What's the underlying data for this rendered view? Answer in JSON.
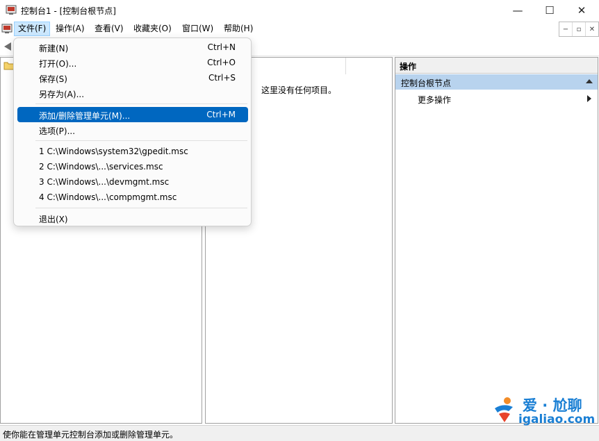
{
  "window": {
    "title": "控制台1 - [控制台根节点]",
    "minimize_glyph": "—",
    "maximize_glyph": "☐",
    "close_glyph": "✕"
  },
  "menubar": {
    "items": [
      "文件(F)",
      "操作(A)",
      "查看(V)",
      "收藏夹(O)",
      "窗口(W)",
      "帮助(H)"
    ],
    "active": "文件(F)"
  },
  "mdi_controls": [
    "−",
    "▫",
    "✕"
  ],
  "file_menu": {
    "new": {
      "label": "新建(N)",
      "shortcut": "Ctrl+N"
    },
    "open": {
      "label": "打开(O)...",
      "shortcut": "Ctrl+O"
    },
    "save": {
      "label": "保存(S)",
      "shortcut": "Ctrl+S"
    },
    "save_as": {
      "label": "另存为(A)..."
    },
    "add_remove": {
      "label": "添加/删除管理单元(M)...",
      "shortcut": "Ctrl+M"
    },
    "options": {
      "label": "选项(P)..."
    },
    "recent": [
      "1 C:\\Windows\\system32\\gpedit.msc",
      "2 C:\\Windows\\...\\services.msc",
      "3 C:\\Windows\\...\\devmgmt.msc",
      "4 C:\\Windows\\...\\compmgmt.msc"
    ],
    "exit": {
      "label": "退出(X)"
    }
  },
  "middle_pane": {
    "empty_message": "这里没有任何项目。"
  },
  "actions_pane": {
    "title": "操作",
    "section": "控制台根节点",
    "more": "更多操作"
  },
  "status_bar": {
    "text": "使你能在管理单元控制台添加或删除管理单元。"
  },
  "watermark": {
    "line1": "爱 · 尬聊",
    "line2": "igaliao.com"
  },
  "colors": {
    "highlight": "#0067c0",
    "section_bg": "#b8d3ee",
    "menu_active": "#cce8ff",
    "watermark": "#1a7fd4"
  },
  "icons": [
    "app-console-icon",
    "back-arrow-icon",
    "folder-icon",
    "collapse-up-icon",
    "expand-right-icon"
  ]
}
